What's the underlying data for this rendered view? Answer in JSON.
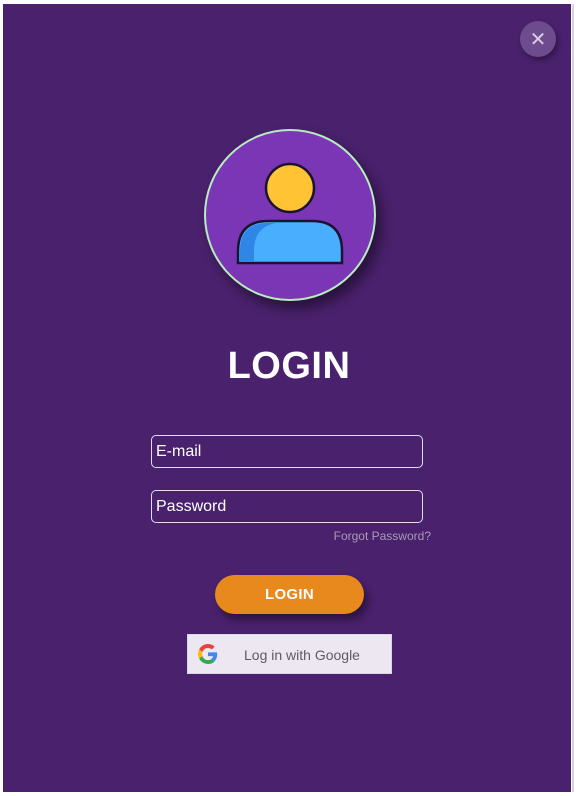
{
  "window": {
    "close_icon": "close-icon",
    "close_glyph": "✕"
  },
  "avatar": {
    "icon": "user-icon"
  },
  "title": "LOGIN",
  "form": {
    "email_placeholder": "E-mail",
    "password_placeholder": "Password",
    "forgot_password": "Forgot Password?",
    "login_button": "LOGIN",
    "google_button": "Log in with Google",
    "google_icon": "google-logo-icon"
  },
  "colors": {
    "background": "#4a216d",
    "avatar_circle": "#7b36b5",
    "avatar_ring": "#b8ecc0",
    "login_button": "#e8891d",
    "google_button": "#ede7f2",
    "head": "#ffc333",
    "body": "#4aaeff"
  }
}
